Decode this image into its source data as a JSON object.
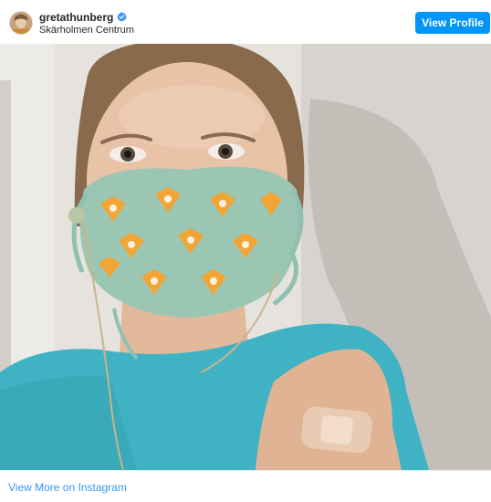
{
  "post": {
    "username": "gretathunberg",
    "location": "Skärholmen Centrum",
    "verified": true,
    "view_profile_label": "View Profile",
    "view_more_label": "View More on Instagram"
  },
  "colors": {
    "accent": "#0095f6",
    "link": "#3897f0",
    "verified_badge": "#3897f0"
  },
  "icons": {
    "verified": "verified-badge-icon",
    "avatar": "profile-avatar"
  }
}
